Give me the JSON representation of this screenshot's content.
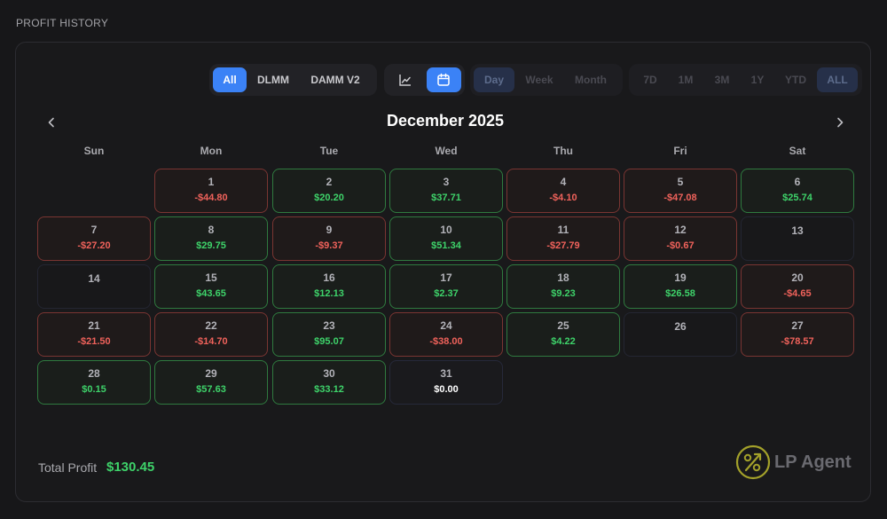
{
  "section_title": "PROFIT HISTORY",
  "filters": {
    "type": [
      {
        "label": "All",
        "active": true
      },
      {
        "label": "DLMM",
        "active": false
      },
      {
        "label": "DAMM V2",
        "active": false
      }
    ],
    "view": [
      {
        "icon": "line-chart-icon",
        "active": false
      },
      {
        "icon": "calendar-icon",
        "active": true
      }
    ],
    "granularity": [
      {
        "label": "Day",
        "active": true
      },
      {
        "label": "Week",
        "active": false
      },
      {
        "label": "Month",
        "active": false
      }
    ],
    "range": [
      {
        "label": "7D",
        "active": false
      },
      {
        "label": "1M",
        "active": false
      },
      {
        "label": "3M",
        "active": false
      },
      {
        "label": "1Y",
        "active": false
      },
      {
        "label": "YTD",
        "active": false
      },
      {
        "label": "ALL",
        "active": true
      }
    ]
  },
  "calendar": {
    "title": "December 2025",
    "weekdays": [
      "Sun",
      "Mon",
      "Tue",
      "Wed",
      "Thu",
      "Fri",
      "Sat"
    ],
    "days": [
      {
        "day": "1",
        "amount": "-$44.80"
      },
      {
        "day": "2",
        "amount": "$20.20"
      },
      {
        "day": "3",
        "amount": "$37.71"
      },
      {
        "day": "4",
        "amount": "-$4.10"
      },
      {
        "day": "5",
        "amount": "-$47.08"
      },
      {
        "day": "6",
        "amount": "$25.74"
      },
      {
        "day": "7",
        "amount": "-$27.20"
      },
      {
        "day": "8",
        "amount": "$29.75"
      },
      {
        "day": "9",
        "amount": "-$9.37"
      },
      {
        "day": "10",
        "amount": "$51.34"
      },
      {
        "day": "11",
        "amount": "-$27.79"
      },
      {
        "day": "12",
        "amount": "-$0.67"
      },
      {
        "day": "13",
        "amount": ""
      },
      {
        "day": "14",
        "amount": ""
      },
      {
        "day": "15",
        "amount": "$43.65"
      },
      {
        "day": "16",
        "amount": "$12.13"
      },
      {
        "day": "17",
        "amount": "$2.37"
      },
      {
        "day": "18",
        "amount": "$9.23"
      },
      {
        "day": "19",
        "amount": "$26.58"
      },
      {
        "day": "20",
        "amount": "-$4.65"
      },
      {
        "day": "21",
        "amount": "-$21.50"
      },
      {
        "day": "22",
        "amount": "-$14.70"
      },
      {
        "day": "23",
        "amount": "$95.07"
      },
      {
        "day": "24",
        "amount": "-$38.00"
      },
      {
        "day": "25",
        "amount": "$4.22"
      },
      {
        "day": "26",
        "amount": ""
      },
      {
        "day": "27",
        "amount": "-$78.57"
      },
      {
        "day": "28",
        "amount": "$0.15"
      },
      {
        "day": "29",
        "amount": "$57.63"
      },
      {
        "day": "30",
        "amount": "$33.12"
      },
      {
        "day": "31",
        "amount": "$0.00"
      }
    ]
  },
  "total": {
    "label": "Total Profit",
    "value": "$130.45"
  },
  "brand": {
    "name": "LP Agent",
    "icon": "percent-growth-logo"
  },
  "colors": {
    "accent": "#3b82f6",
    "positive": "#3ed36a",
    "negative": "#f0625b",
    "brand_logo": "#a3a12a"
  }
}
